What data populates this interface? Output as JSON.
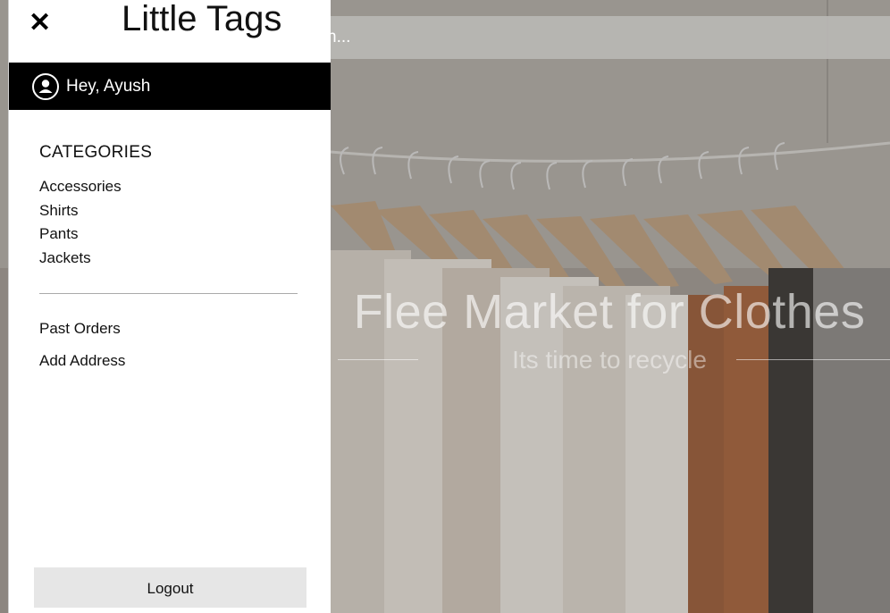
{
  "drawer": {
    "close_icon": "close-icon",
    "brand": "Little Tags",
    "greeting": "Hey, Ayush",
    "user_icon": "user-circle-icon",
    "categories_heading": "CATEGORIES",
    "categories": [
      "Accessories",
      "Shirts",
      "Pants",
      "Jackets"
    ],
    "links": {
      "past_orders": "Past Orders",
      "add_address": "Add Address"
    },
    "logout_label": "Logout"
  },
  "hero": {
    "search_placeholder": "h...",
    "title": "Flee Market for Clothes",
    "subtitle": "Its time to recycle"
  },
  "colors": {
    "drawer_bg": "#ffffff",
    "user_bar_bg": "#000000",
    "logout_bg": "#e6e6e6"
  }
}
